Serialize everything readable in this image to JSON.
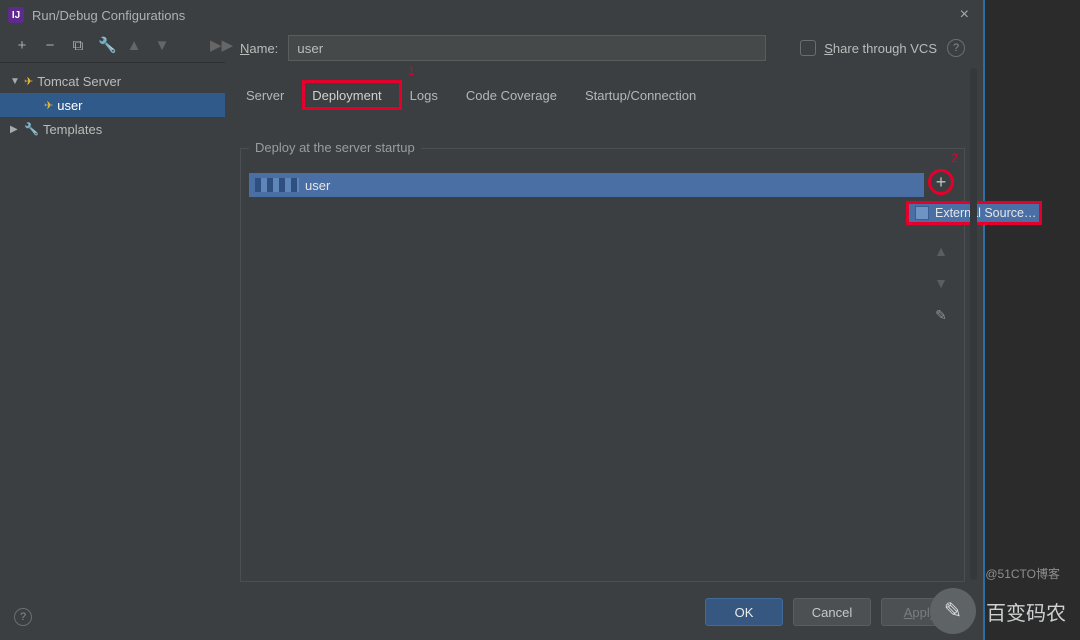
{
  "window": {
    "title": "Run/Debug Configurations"
  },
  "toolbar_icons": [
    "+",
    "−",
    "⧉",
    "🔧",
    "▲",
    "▼",
    "▶▶"
  ],
  "tree": {
    "items": [
      {
        "label": "Tomcat Server",
        "expanded": true,
        "children": [
          {
            "label": "user",
            "selected": true
          }
        ]
      },
      {
        "label": "Templates",
        "expanded": false
      }
    ]
  },
  "name_field": {
    "label_u": "N",
    "label": "ame:",
    "value": "user"
  },
  "share": {
    "label_u": "S",
    "label": "hare through VCS"
  },
  "tabs": [
    "Server",
    "Deployment",
    "Logs",
    "Code Coverage",
    "Startup/Connection"
  ],
  "active_tab_index": 1,
  "fieldset_legend": "Deploy at the server startup",
  "deploy_item": "user",
  "popup_item": "External Source…",
  "side_tools": {
    "minus": "−",
    "up": "▲",
    "down": "▼",
    "edit": "✎"
  },
  "annotations": {
    "one": "1",
    "two": "2"
  },
  "buttons": {
    "ok": "OK",
    "cancel": "Cancel",
    "apply_u": "A",
    "apply": "pply"
  },
  "watermark": {
    "brand": "百变码农",
    "credit": "@51CTO博客"
  }
}
